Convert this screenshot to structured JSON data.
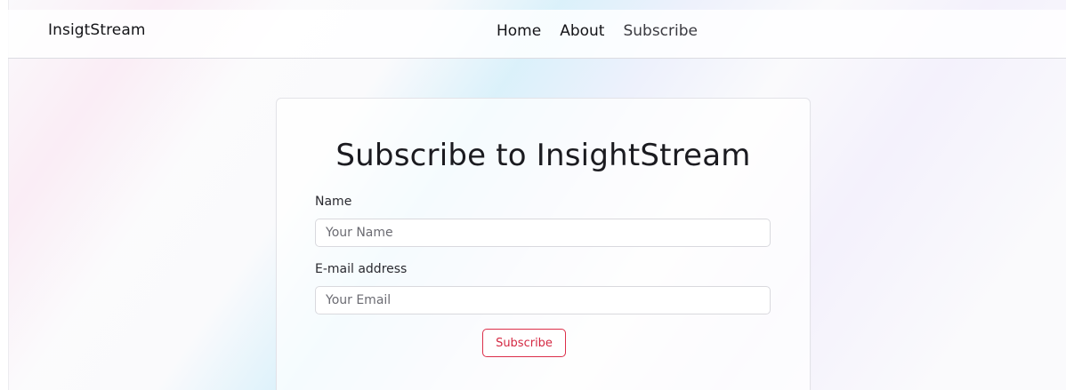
{
  "navbar": {
    "brand": "InsigtStream",
    "links": [
      {
        "label": "Home"
      },
      {
        "label": "About"
      },
      {
        "label": "Subscribe"
      }
    ]
  },
  "form": {
    "title": "Subscribe to InsightStream",
    "name_label": "Name",
    "name_placeholder": "Your Name",
    "name_value": "",
    "email_label": "E-mail address",
    "email_placeholder": "Your Email",
    "email_value": "",
    "submit_label": "Subscribe"
  },
  "colors": {
    "accent": "#dc2f4a",
    "text": "#1f1f24",
    "border": "#d9d9de"
  }
}
